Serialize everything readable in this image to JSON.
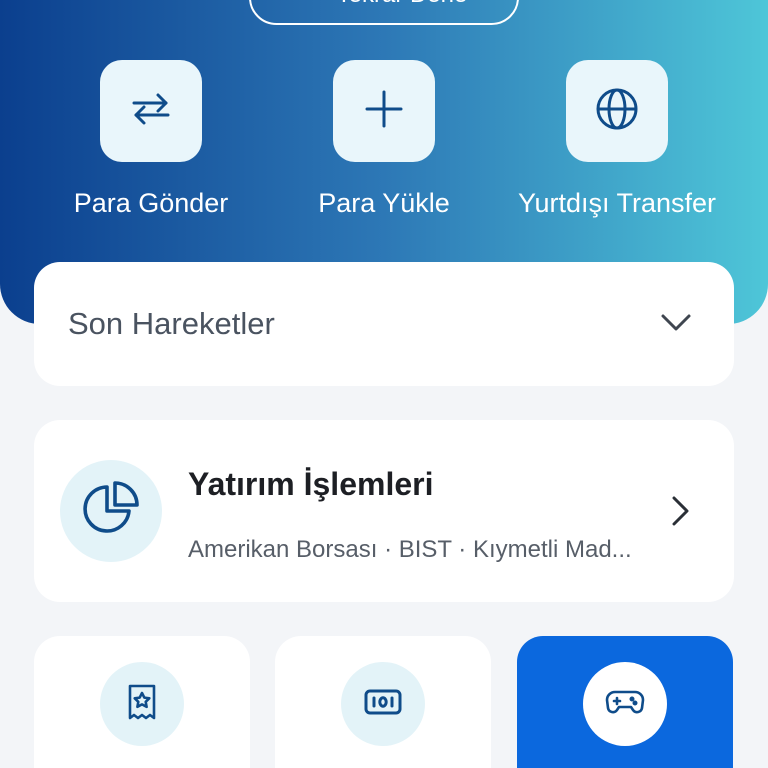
{
  "header": {
    "retry_label": "Tekrar Dene",
    "retry_icon": "refresh-icon",
    "actions": [
      {
        "label": "Para Gönder",
        "icon": "swap-arrows-icon"
      },
      {
        "label": "Para Yükle",
        "icon": "plus-icon"
      },
      {
        "label": "Yurtdışı Transfer",
        "icon": "globe-icon"
      }
    ],
    "gradient_colors": [
      "#0b3f8e",
      "#4ec6d8"
    ]
  },
  "recent_transactions": {
    "title": "Son Hareketler",
    "icon": "chevron-down-icon"
  },
  "investment": {
    "title": "Yatırım İşlemleri",
    "subtitle": "Amerikan Borsası · BIST · Kıymetli Mad...",
    "icon": "pie-chart-icon"
  },
  "quick_tiles": [
    {
      "icon": "receipt-star-icon",
      "active": false
    },
    {
      "icon": "banknote-icon",
      "active": false
    },
    {
      "icon": "gamepad-icon",
      "active": true
    }
  ],
  "colors": {
    "accent": "#0b68de",
    "icon": "#0f4c8a",
    "background": "#f3f5f8"
  }
}
